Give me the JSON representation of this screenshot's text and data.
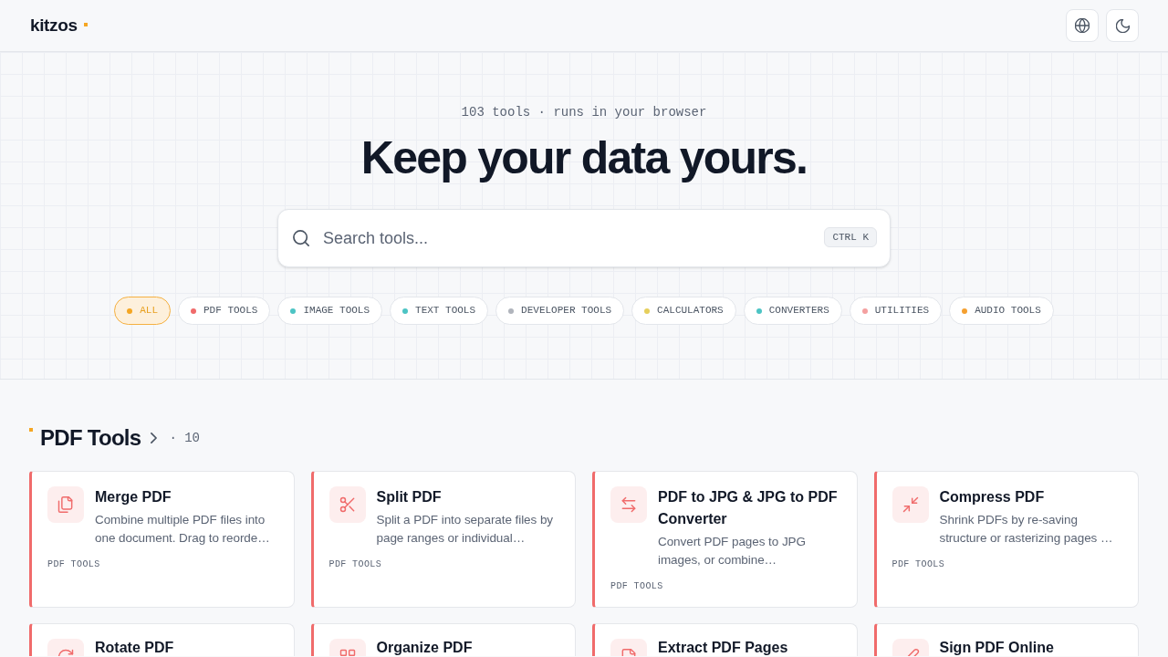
{
  "header": {
    "logo": "kitzos"
  },
  "hero": {
    "tagline": "103 tools · runs in your browser",
    "title": "Keep your data yours.",
    "search": {
      "placeholder": "Search tools...",
      "shortcut": "CTRL K"
    }
  },
  "filters": [
    {
      "label": "ALL",
      "selected": true,
      "color": "#f5a623"
    },
    {
      "label": "PDF TOOLS",
      "selected": false,
      "color": "#f06b6b"
    },
    {
      "label": "IMAGE TOOLS",
      "selected": false,
      "color": "#4cc4c4"
    },
    {
      "label": "TEXT TOOLS",
      "selected": false,
      "color": "#4cc4c4"
    },
    {
      "label": "DEVELOPER TOOLS",
      "selected": false,
      "color": "#b0b4bc"
    },
    {
      "label": "CALCULATORS",
      "selected": false,
      "color": "#e6cf5c"
    },
    {
      "label": "CONVERTERS",
      "selected": false,
      "color": "#4cc4c4"
    },
    {
      "label": "UTILITIES",
      "selected": false,
      "color": "#f4a0a0"
    },
    {
      "label": "AUDIO TOOLS",
      "selected": false,
      "color": "#f5a030"
    }
  ],
  "section": {
    "title": "PDF Tools",
    "count": "· 10",
    "tools": [
      {
        "title": "Merge PDF",
        "description": "Combine multiple PDF files into one document. Drag to reorde…",
        "tag": "PDF TOOLS"
      },
      {
        "title": "Split PDF",
        "description": "Split a PDF into separate files by page ranges or individual…",
        "tag": "PDF TOOLS"
      },
      {
        "title": "PDF to JPG & JPG to PDF Converter",
        "description": "Convert PDF pages to JPG images, or combine…",
        "tag": "PDF TOOLS"
      },
      {
        "title": "Compress PDF",
        "description": "Shrink PDFs by re-saving structure or rasterizing pages …",
        "tag": "PDF TOOLS"
      },
      {
        "title": "Rotate PDF"
      },
      {
        "title": "Organize PDF"
      },
      {
        "title": "Extract PDF Pages"
      },
      {
        "title": "Sign PDF Online"
      }
    ]
  }
}
